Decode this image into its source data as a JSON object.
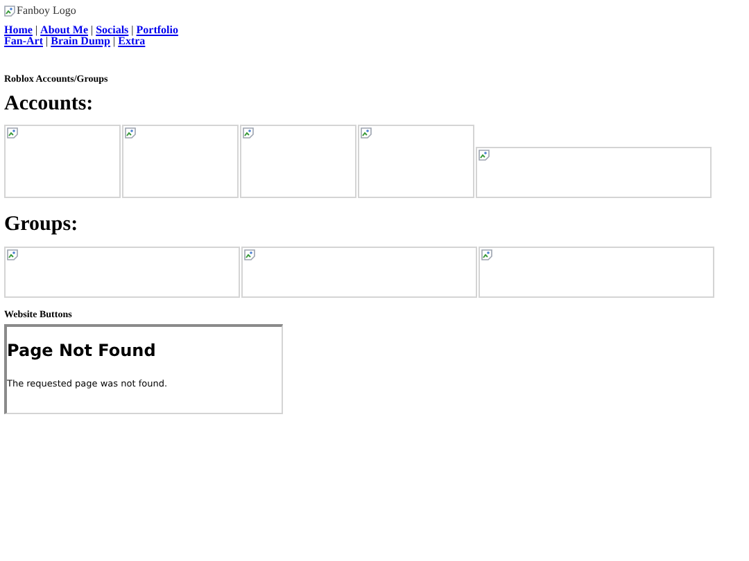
{
  "logo": {
    "alt": "Fanboy Logo"
  },
  "nav": [
    [
      "Home",
      "About Me",
      "Socials",
      "Portfolio"
    ],
    [
      "Fan-Art",
      "Brain Dump",
      "Extra"
    ]
  ],
  "nav_separator": "|",
  "section_title": "Roblox Accounts/Groups",
  "accounts": {
    "heading": "Accounts:",
    "images": [
      {
        "kind": "square"
      },
      {
        "kind": "square"
      },
      {
        "kind": "square"
      },
      {
        "kind": "square"
      },
      {
        "kind": "wide"
      }
    ]
  },
  "groups": {
    "heading": "Groups:",
    "images": [
      {
        "kind": "wide"
      },
      {
        "kind": "wide"
      },
      {
        "kind": "wide"
      }
    ]
  },
  "buttons_title": "Website Buttons",
  "embed": {
    "heading": "Page Not Found",
    "message": "The requested page was not found."
  }
}
